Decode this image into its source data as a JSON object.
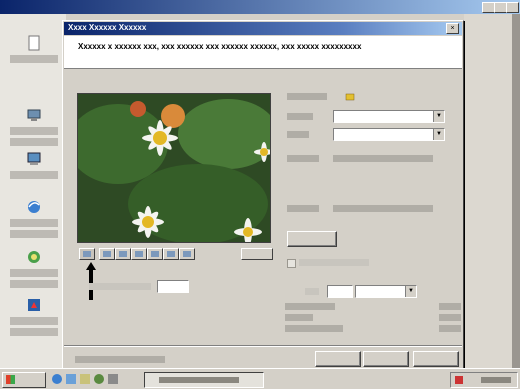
{
  "window": {
    "title": "Xxxx Xxxxxx Xxxxxx",
    "instruction": "Xxxxxx x xxxxxx xxx, xxx xxxxxx xxx xxxxxx xxxxxx, xxx xxxxx xxxxxxxxx"
  },
  "desktop_icons": [
    {
      "name": "new-item-icon"
    },
    {
      "name": "network-icon"
    },
    {
      "name": "computer-icon"
    },
    {
      "name": "internet-explorer-icon"
    },
    {
      "name": "connect-icon"
    },
    {
      "name": "media-icon"
    }
  ],
  "right_panel": {
    "record_settings_icon": "folder-icon"
  },
  "colors": {
    "titlebar": "#0a246a",
    "desktop": "#3a6ea5",
    "face": "#d4d0c8"
  }
}
